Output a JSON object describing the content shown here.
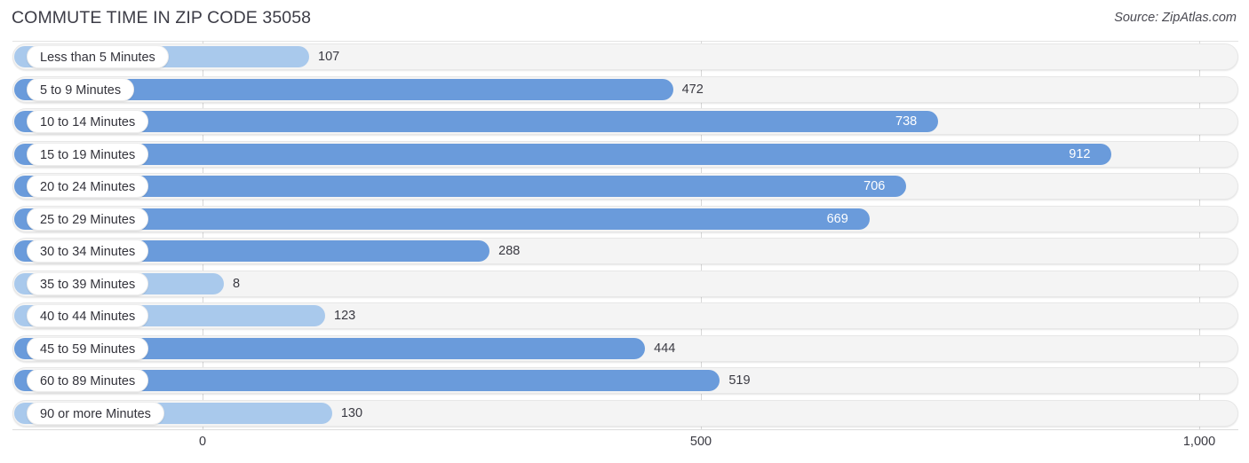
{
  "header": {
    "title": "COMMUTE TIME IN ZIP CODE 35058",
    "source": "Source: ZipAtlas.com"
  },
  "colors": {
    "bar": "#6a9bdb",
    "bar_pale": "#a9c9ec",
    "track": "#f4f4f4",
    "value_inside": "#ffffff",
    "value_outside": "#3a3a42",
    "gridline": "#d8d8d8"
  },
  "chart_data": {
    "type": "bar",
    "orientation": "horizontal",
    "title": "COMMUTE TIME IN ZIP CODE 35058",
    "subtitle": "",
    "xlabel": "",
    "ylabel": "",
    "xlim": [
      0,
      1000
    ],
    "grid": true,
    "legend": null,
    "source": "Source: ZipAtlas.com",
    "ticks": [
      "0",
      "500",
      "1,000"
    ],
    "tick_values": [
      0,
      500,
      1000
    ],
    "categories": [
      "Less than 5 Minutes",
      "5 to 9 Minutes",
      "10 to 14 Minutes",
      "15 to 19 Minutes",
      "20 to 24 Minutes",
      "25 to 29 Minutes",
      "30 to 34 Minutes",
      "35 to 39 Minutes",
      "40 to 44 Minutes",
      "45 to 59 Minutes",
      "60 to 89 Minutes",
      "90 or more Minutes"
    ],
    "values": [
      107,
      472,
      738,
      912,
      706,
      669,
      288,
      8,
      123,
      444,
      519,
      130
    ],
    "value_labels": [
      "107",
      "472",
      "738",
      "912",
      "706",
      "669",
      "288",
      "8",
      "123",
      "444",
      "519",
      "130"
    ]
  },
  "rows": [
    {
      "label": "Less than 5 Minutes",
      "value": 107,
      "value_label": "107",
      "inside": false,
      "pale": true
    },
    {
      "label": "5 to 9 Minutes",
      "value": 472,
      "value_label": "472",
      "inside": false,
      "pale": false
    },
    {
      "label": "10 to 14 Minutes",
      "value": 738,
      "value_label": "738",
      "inside": true,
      "pale": false
    },
    {
      "label": "15 to 19 Minutes",
      "value": 912,
      "value_label": "912",
      "inside": true,
      "pale": false
    },
    {
      "label": "20 to 24 Minutes",
      "value": 706,
      "value_label": "706",
      "inside": true,
      "pale": false
    },
    {
      "label": "25 to 29 Minutes",
      "value": 669,
      "value_label": "669",
      "inside": true,
      "pale": false
    },
    {
      "label": "30 to 34 Minutes",
      "value": 288,
      "value_label": "288",
      "inside": false,
      "pale": false
    },
    {
      "label": "35 to 39 Minutes",
      "value": 8,
      "value_label": "8",
      "inside": false,
      "pale": true
    },
    {
      "label": "40 to 44 Minutes",
      "value": 123,
      "value_label": "123",
      "inside": false,
      "pale": true
    },
    {
      "label": "45 to 59 Minutes",
      "value": 444,
      "value_label": "444",
      "inside": false,
      "pale": false
    },
    {
      "label": "60 to 89 Minutes",
      "value": 519,
      "value_label": "519",
      "inside": false,
      "pale": false
    },
    {
      "label": "90 or more Minutes",
      "value": 130,
      "value_label": "130",
      "inside": false,
      "pale": true
    }
  ]
}
